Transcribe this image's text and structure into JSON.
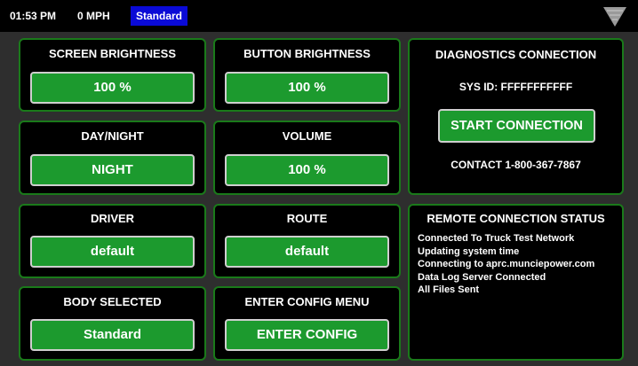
{
  "status_bar": {
    "time": "01:53 PM",
    "speed": "0 MPH",
    "mode": "Standard",
    "menu_icon": "triangle-down-menu-icon"
  },
  "colors": {
    "panel_border": "#1a7a1a",
    "button_green": "#1c9a2e",
    "mode_badge": "#0a0ad6",
    "background": "#2e2e2e"
  },
  "controls": [
    {
      "title": "SCREEN BRIGHTNESS",
      "value": "100 %"
    },
    {
      "title": "BUTTON BRIGHTNESS",
      "value": "100 %"
    },
    {
      "title": "DAY/NIGHT",
      "value": "NIGHT"
    },
    {
      "title": "VOLUME",
      "value": "100 %"
    },
    {
      "title": "DRIVER",
      "value": "default"
    },
    {
      "title": "ROUTE",
      "value": "default"
    },
    {
      "title": "BODY SELECTED",
      "value": "Standard"
    },
    {
      "title": "ENTER CONFIG MENU",
      "value": "ENTER CONFIG"
    }
  ],
  "diagnostics": {
    "title": "DIAGNOSTICS CONNECTION",
    "sys_id": "SYS ID: FFFFFFFFFFF",
    "button_label": "START CONNECTION",
    "contact": "CONTACT 1-800-367-7867"
  },
  "remote": {
    "title": "REMOTE CONNECTION STATUS",
    "lines": [
      "Connected To Truck Test Network",
      "Updating system time",
      "Connecting to aprc.munciepower.com",
      "Data Log Server Connected",
      "All Files Sent"
    ]
  }
}
